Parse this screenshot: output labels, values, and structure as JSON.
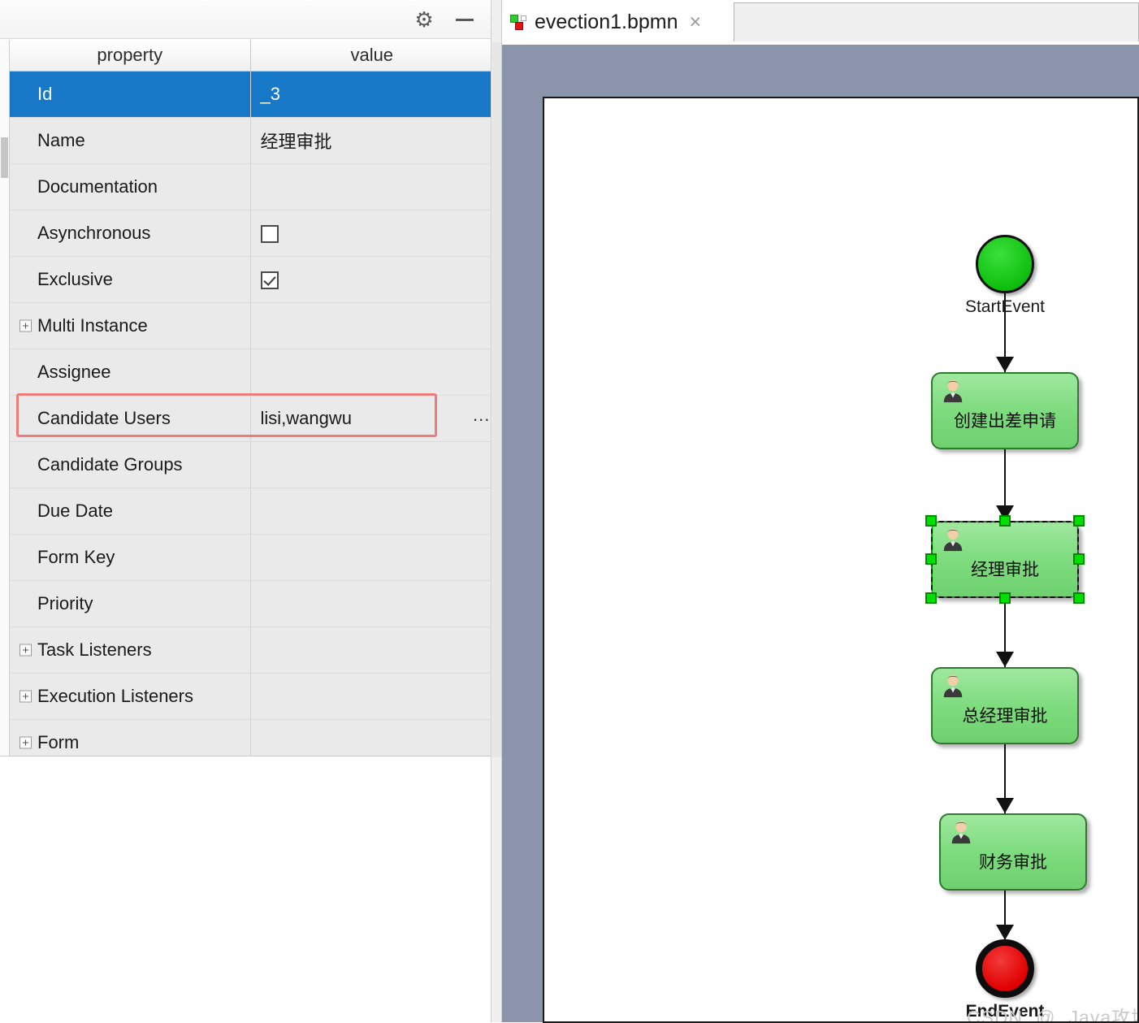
{
  "panel": {
    "title_icons": {
      "gear": "gear-icon",
      "gear_glyph": "⚙",
      "minimize": "minimize-icon"
    },
    "table": {
      "headers": [
        "property",
        "value"
      ],
      "rows": [
        {
          "property": "Id",
          "value": "_3",
          "type": "text",
          "selected": true,
          "expandable": false
        },
        {
          "property": "Name",
          "value": "经理审批",
          "type": "text",
          "selected": false,
          "expandable": false
        },
        {
          "property": "Documentation",
          "value": "",
          "type": "text",
          "selected": false,
          "expandable": false
        },
        {
          "property": "Asynchronous",
          "value": "",
          "type": "checkbox",
          "checked": false,
          "selected": false,
          "expandable": false
        },
        {
          "property": "Exclusive",
          "value": "",
          "type": "checkbox",
          "checked": true,
          "selected": false,
          "expandable": false
        },
        {
          "property": "Multi Instance",
          "value": "",
          "type": "text",
          "selected": false,
          "expandable": true
        },
        {
          "property": "Assignee",
          "value": "",
          "type": "text",
          "selected": false,
          "expandable": false
        },
        {
          "property": "Candidate Users",
          "value": "lisi,wangwu",
          "type": "text",
          "selected": false,
          "expandable": false,
          "highlighted": true
        },
        {
          "property": "Candidate Groups",
          "value": "",
          "type": "text",
          "selected": false,
          "expandable": false
        },
        {
          "property": "Due Date",
          "value": "",
          "type": "text",
          "selected": false,
          "expandable": false
        },
        {
          "property": "Form Key",
          "value": "",
          "type": "text",
          "selected": false,
          "expandable": false
        },
        {
          "property": "Priority",
          "value": "",
          "type": "text",
          "selected": false,
          "expandable": false
        },
        {
          "property": "Task Listeners",
          "value": "",
          "type": "text",
          "selected": false,
          "expandable": true
        },
        {
          "property": "Execution Listeners",
          "value": "",
          "type": "text",
          "selected": false,
          "expandable": true
        },
        {
          "property": "Form",
          "value": "",
          "type": "text",
          "selected": false,
          "expandable": true
        }
      ]
    },
    "ellipsis_button": "..."
  },
  "editor": {
    "tab": {
      "label": "evection1.bpmn",
      "close": "×",
      "icon": "bpmn-file-icon"
    },
    "diagram": {
      "start_event": {
        "label": "StartEvent",
        "color": "#0fbf0f"
      },
      "end_event": {
        "label": "EndEvent",
        "color": "#e00000"
      },
      "tasks": [
        {
          "label": "创建出差申请",
          "selected": false
        },
        {
          "label": "经理审批",
          "selected": true
        },
        {
          "label": "总经理审批",
          "selected": false
        },
        {
          "label": "财务审批",
          "selected": false
        }
      ],
      "task_fill": "#7edc7e"
    },
    "watermark": {
      "prefix": "CSDN",
      "at": "@",
      "author": "Java攻城狮"
    }
  }
}
